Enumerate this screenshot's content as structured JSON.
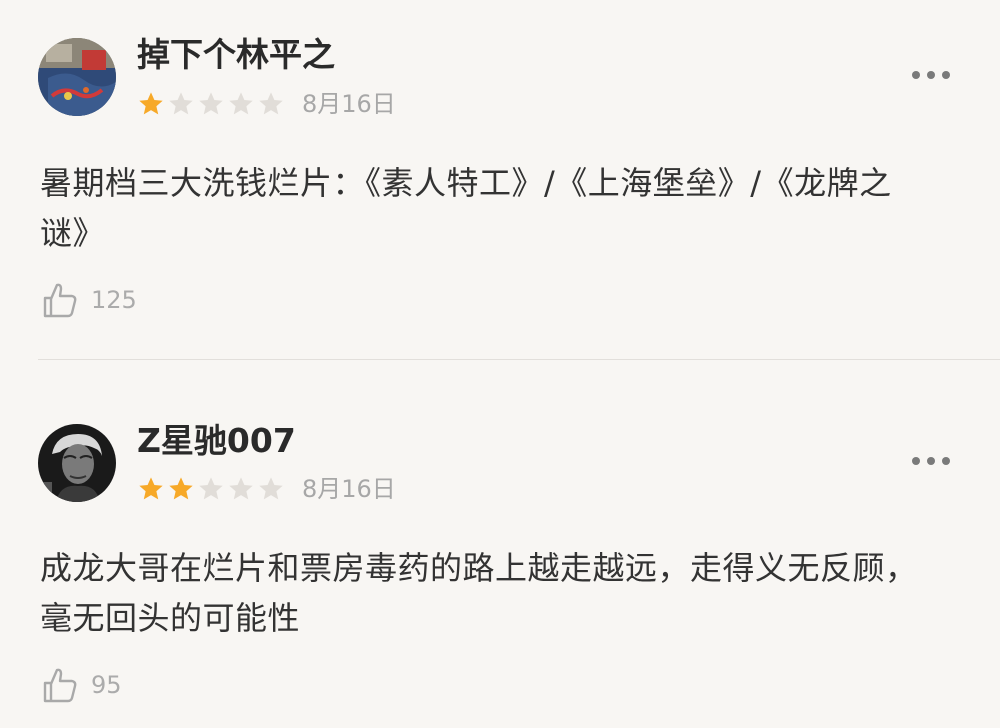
{
  "reviews": [
    {
      "username": "掉下个林平之",
      "rating": 1,
      "max_rating": 5,
      "date": "8月16日",
      "content": "暑期档三大洗钱烂片：《素人特工》/《上海堡垒》/《龙牌之谜》",
      "likes": "125",
      "avatar_icon": "avatar-photo-denim-jacket",
      "more_icon": "more-dots-icon"
    },
    {
      "username": "Z星驰007",
      "rating": 2,
      "max_rating": 5,
      "date": "8月16日",
      "content": "成龙大哥在烂片和票房毒药的路上越走越远，走得义无反顾，毫无回头的可能性",
      "likes": "95",
      "avatar_icon": "avatar-photo-bw-portrait",
      "more_icon": "more-dots-icon"
    }
  ],
  "colors": {
    "background": "#f8f6f3",
    "star_filled": "#f7a928",
    "star_empty": "#e1ddd8",
    "text_primary": "#333333",
    "text_secondary": "#a7a7a7"
  }
}
